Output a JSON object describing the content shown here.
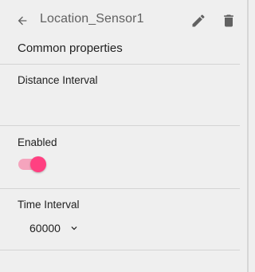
{
  "header": {
    "title": "Location_Sensor1",
    "back_icon": "arrow-back-icon",
    "edit_icon": "pencil-icon",
    "delete_icon": "trash-icon"
  },
  "section": {
    "title": "Common properties"
  },
  "fields": {
    "distance_interval": {
      "label": "Distance Interval"
    },
    "enabled": {
      "label": "Enabled",
      "value": true
    },
    "time_interval": {
      "label": "Time Interval",
      "value": "60000",
      "icon": "chevron-down-icon"
    }
  },
  "colors": {
    "background": "#efefef",
    "toggle_thumb": "#ff4081",
    "toggle_track": "#f5a4bd",
    "icon": "#616161"
  }
}
